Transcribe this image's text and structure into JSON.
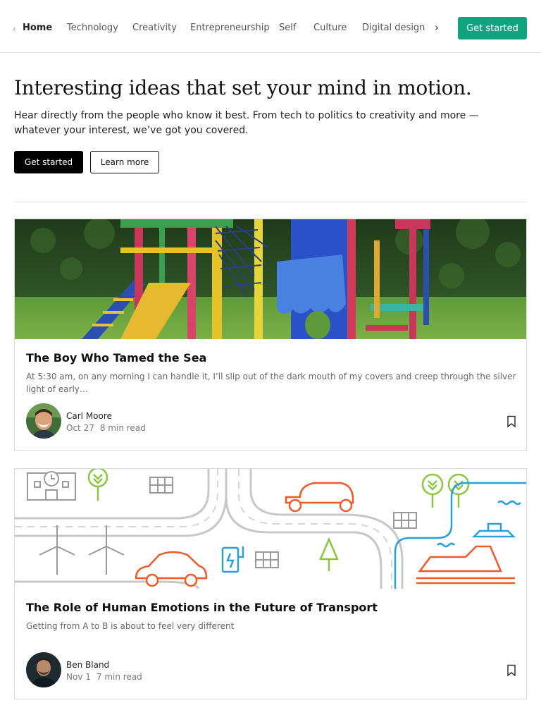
{
  "nav": {
    "items": [
      "Home",
      "Technology",
      "Creativity",
      "Entrepreneurship",
      "Self",
      "Culture",
      "Digital design"
    ],
    "active": "Home",
    "cta_label": "Get started",
    "left_icon": "chevron-left-icon",
    "right_icon": "chevron-right-icon"
  },
  "hero": {
    "title": "Interesting ideas that set your mind in motion.",
    "subtitle": "Hear directly from the people who know it best. From tech to politics to creativity and more — whatever your interest, we’ve got you covered.",
    "primary_label": "Get started",
    "secondary_label": "Learn more"
  },
  "posts": [
    {
      "title": "The Boy Who Tamed the Sea",
      "excerpt": "At 5:30 am, on any morning I can handle it, I’ll slip out of the dark mouth of my covers and creep through the silver light of early…",
      "author": "Carl Moore",
      "date": "Oct 27",
      "read_time": "8 min read",
      "image": "playground-photo",
      "icon": "bookmark-icon"
    },
    {
      "title": "The Role of Human Emotions in the Future of Transport",
      "excerpt": "Getting from A to B is about to feel very different",
      "author": "Ben Bland",
      "date": "Nov 1",
      "read_time": "7 min read",
      "image": "transport-illustration",
      "icon": "bookmark-icon"
    }
  ],
  "colors": {
    "accent": "#0fa37f",
    "text": "#222222",
    "muted": "#777777",
    "border": "#d8d8d8",
    "illustration_orange": "#ee5a2a",
    "illustration_green": "#8cc63f",
    "illustration_blue": "#2a9fd8"
  }
}
